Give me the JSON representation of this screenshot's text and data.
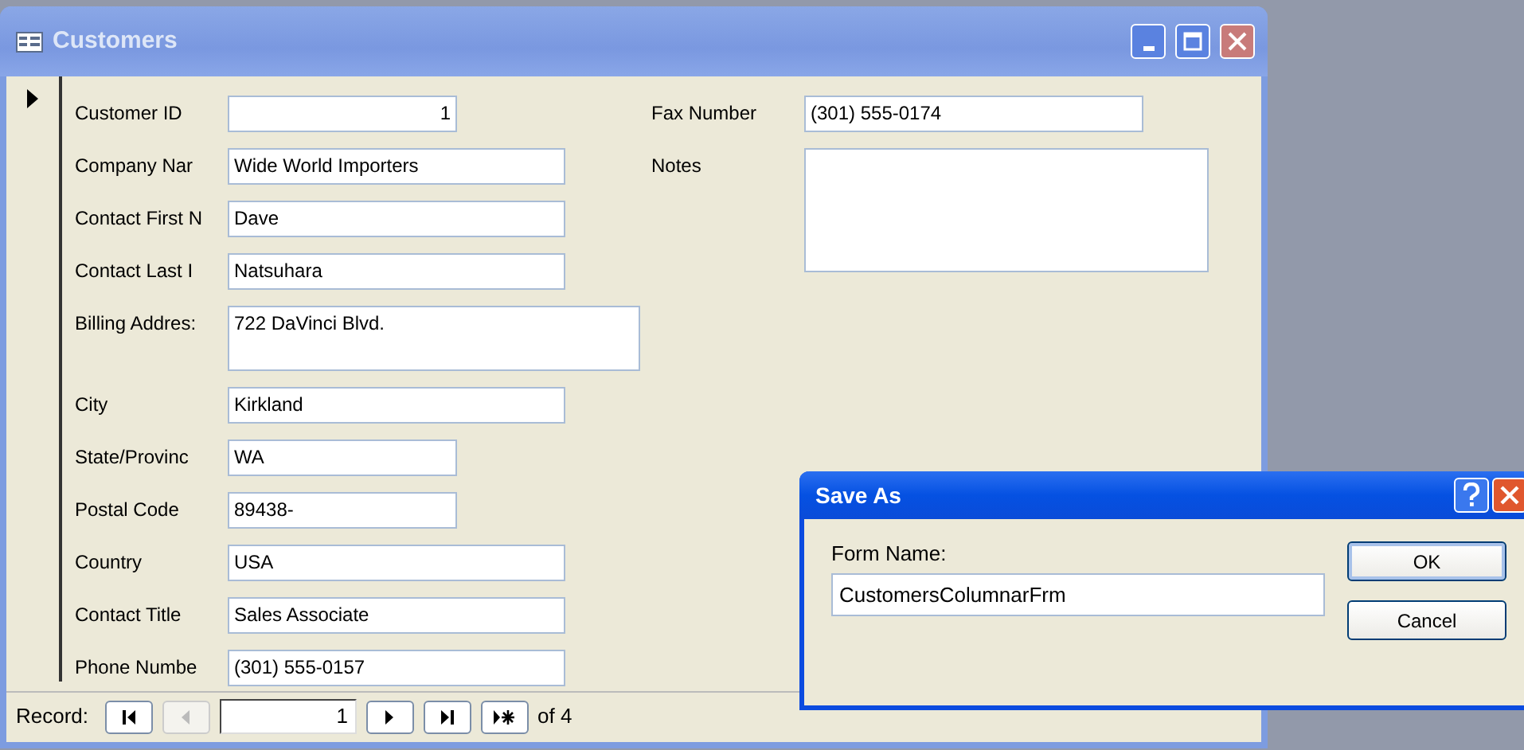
{
  "window": {
    "title": "Customers"
  },
  "left_fields": [
    {
      "label": "Customer ID",
      "value": "1",
      "kind": "number"
    },
    {
      "label": "Company Nar",
      "value": "Wide World Importers",
      "kind": "text"
    },
    {
      "label": "Contact First N",
      "value": "Dave",
      "kind": "text"
    },
    {
      "label": "Contact Last I",
      "value": "Natsuhara",
      "kind": "text"
    },
    {
      "label": "Billing Addres:",
      "value": "722 DaVinci Blvd.",
      "kind": "memo"
    },
    {
      "label": "City",
      "value": "Kirkland",
      "kind": "text"
    },
    {
      "label": "State/Provinc",
      "value": "WA",
      "kind": "text"
    },
    {
      "label": "Postal Code",
      "value": "89438-",
      "kind": "text"
    },
    {
      "label": "Country",
      "value": "USA",
      "kind": "text"
    },
    {
      "label": "Contact Title",
      "value": "Sales Associate",
      "kind": "text"
    },
    {
      "label": "Phone Numbe",
      "value": "(301) 555-0157",
      "kind": "text"
    }
  ],
  "right_fields": [
    {
      "label": "Fax Number",
      "value": "(301) 555-0174",
      "kind": "text"
    },
    {
      "label": "Notes",
      "kind": "memo"
    }
  ],
  "navigation": {
    "label": "Record:",
    "current": "1",
    "total": "of 4",
    "buttons": [
      {
        "kind": "first",
        "disabled": false
      },
      {
        "kind": "previous",
        "disabled": true
      },
      {
        "kind": "next",
        "disabled": false
      },
      {
        "kind": "last",
        "disabled": false
      },
      {
        "kind": "new",
        "disabled": false
      }
    ]
  },
  "dialog": {
    "title": "Save As",
    "field_label": "Form Name:",
    "value": "CustomersColumnarFrm",
    "buttons": [
      "OK",
      "Cancel"
    ]
  }
}
